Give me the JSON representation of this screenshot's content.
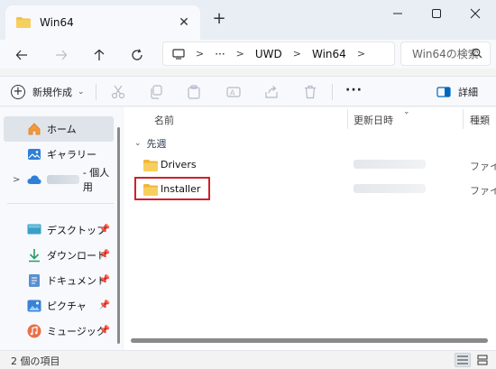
{
  "tab": {
    "title": "Win64"
  },
  "address": {
    "crumbs": [
      "UWD",
      "Win64"
    ],
    "ellipsis": "···"
  },
  "search": {
    "placeholder": "Win64の検索"
  },
  "toolbar": {
    "new_label": "新規作成",
    "more_label": "···",
    "details_label": "詳細"
  },
  "nav": {
    "items": [
      {
        "label": "ホーム",
        "icon": "home-icon",
        "selected": true
      },
      {
        "label": "ギャラリー",
        "icon": "gallery-icon"
      },
      {
        "label": "- 個人用",
        "icon": "onedrive-icon"
      },
      {
        "label": "デスクトップ",
        "icon": "desktop-icon"
      },
      {
        "label": "ダウンロード",
        "icon": "download-icon"
      },
      {
        "label": "ドキュメント",
        "icon": "documents-icon"
      },
      {
        "label": "ピクチャ",
        "icon": "pictures-icon"
      },
      {
        "label": "ミュージック",
        "icon": "music-icon"
      }
    ]
  },
  "columns": {
    "name": "名前",
    "date": "更新日時",
    "type": "種類"
  },
  "group": {
    "label": "先週"
  },
  "files": [
    {
      "name": "Drivers",
      "type": "ファイル"
    },
    {
      "name": "Installer",
      "type": "ファイル"
    }
  ],
  "status": {
    "count_text": "2 個の項目"
  },
  "colors": {
    "folder": "#f4c24a",
    "highlight": "#d0202a",
    "accent": "#0067c0"
  }
}
